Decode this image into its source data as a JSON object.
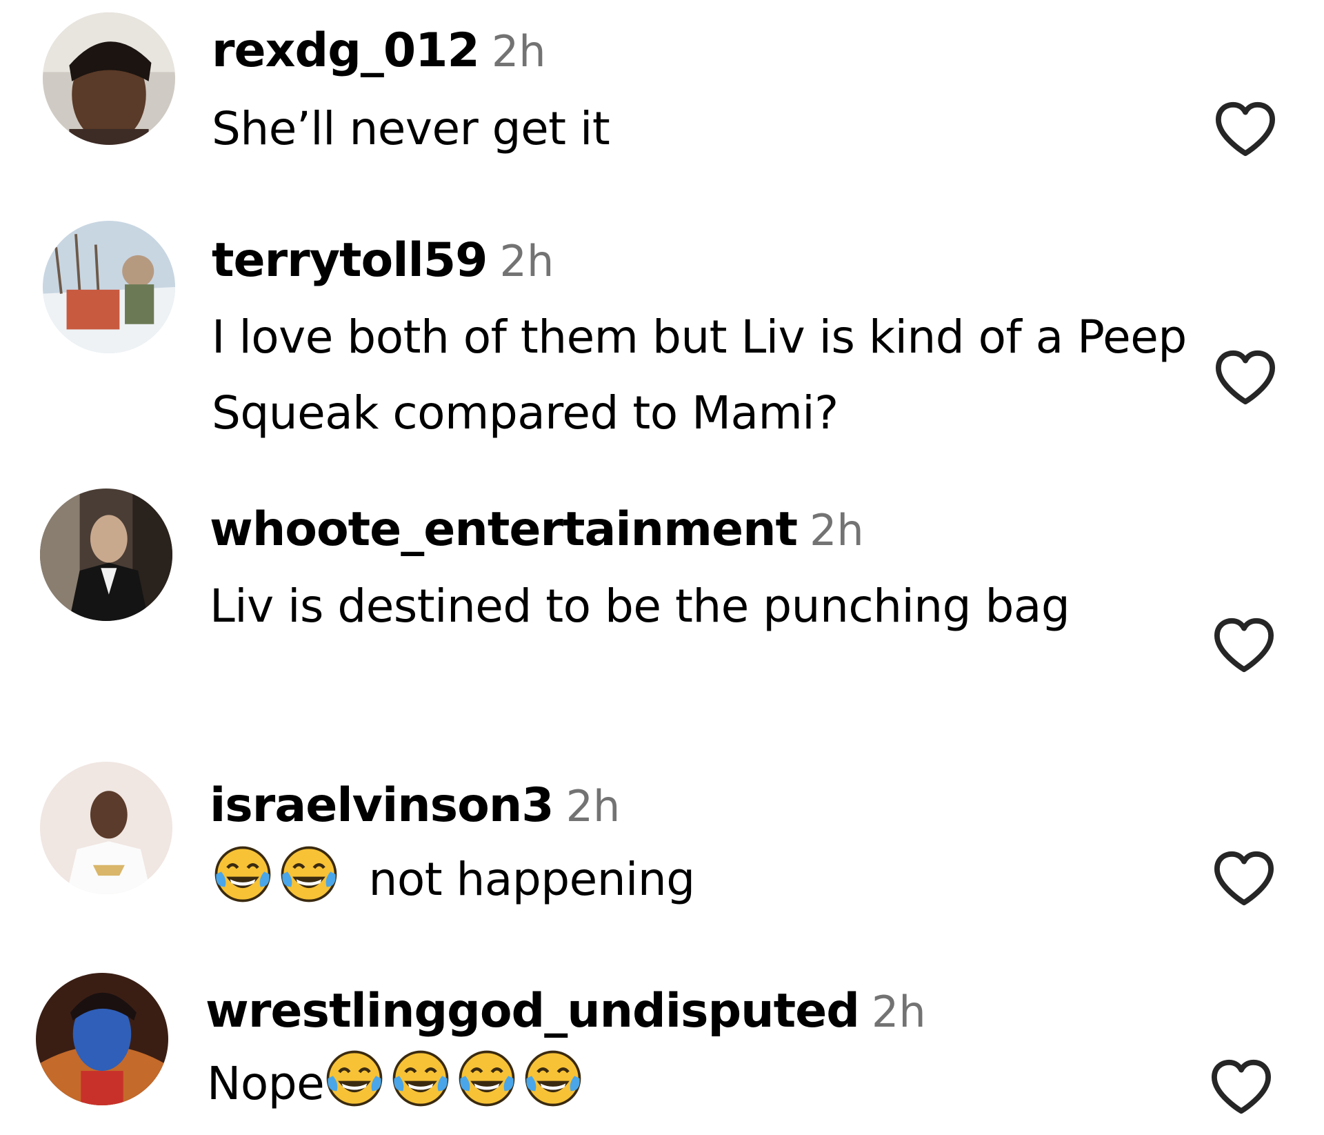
{
  "comments": [
    {
      "username": "rexdg_012",
      "time": "2h",
      "text": "She’ll never get it",
      "emoji_count": 0,
      "avatar_icon": "user-photo-avatar"
    },
    {
      "username": "terrytoll59",
      "time": "2h",
      "text": "I love both of them but Liv is kind of a Peep Squeak compared to Mami?",
      "emoji_count": 0,
      "avatar_icon": "user-photo-avatar"
    },
    {
      "username": "whoote_entertainment",
      "time": "2h",
      "text": "Liv is destined to be the punching bag",
      "emoji_count": 0,
      "avatar_icon": "user-photo-avatar"
    },
    {
      "username": "israelvinson3",
      "time": "2h",
      "text": "not happening",
      "emoji_count": 2,
      "emoji_position": "before",
      "emoji": "face-with-tears-of-joy",
      "avatar_icon": "user-photo-avatar"
    },
    {
      "username": "wrestlinggod_undisputed",
      "time": "2h",
      "text": "Nope",
      "emoji_count": 4,
      "emoji_position": "after",
      "emoji": "face-with-tears-of-joy",
      "avatar_icon": "user-photo-avatar"
    }
  ],
  "like_icon": "heart-outline-icon",
  "colors": {
    "username": "#000000",
    "timestamp": "#737373",
    "heart_outline": "#262626"
  }
}
